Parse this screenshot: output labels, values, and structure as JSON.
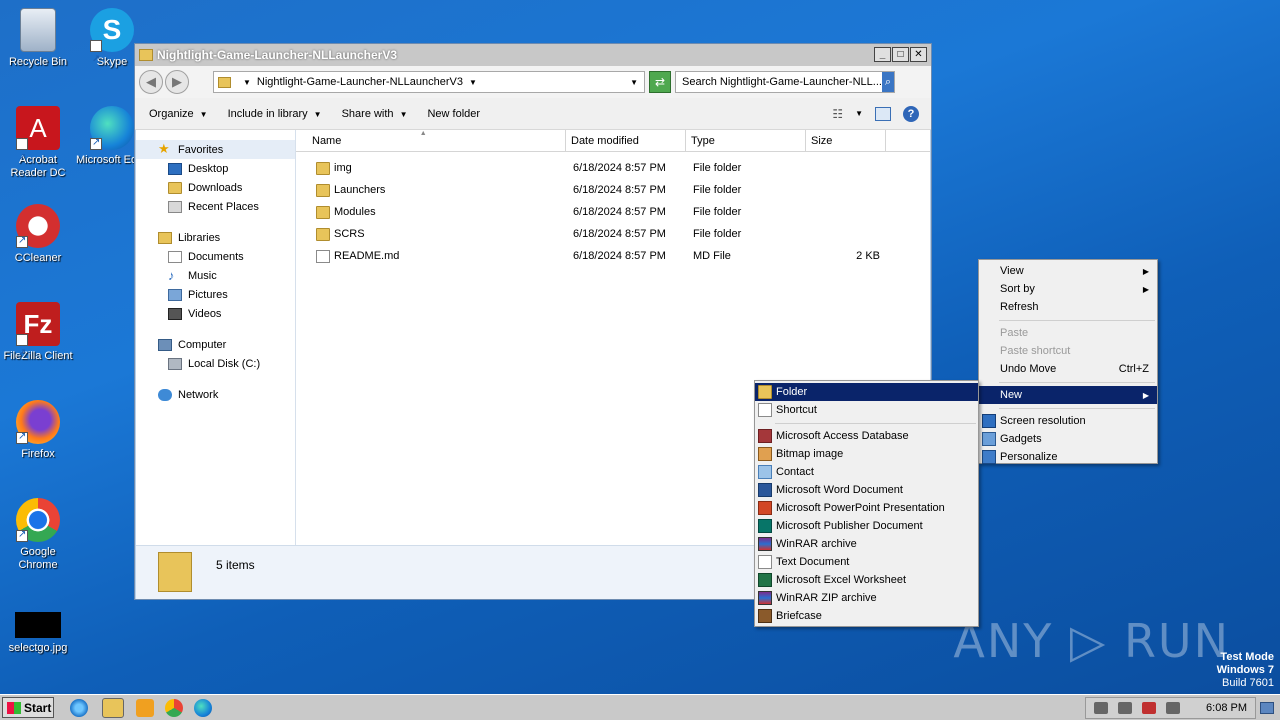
{
  "desktop": {
    "icons": [
      {
        "label": "Recycle Bin"
      },
      {
        "label": "Skype"
      },
      {
        "label": "Acrobat Reader DC"
      },
      {
        "label": "Microsoft Ed"
      },
      {
        "label": "CCleaner"
      },
      {
        "label": "FileZilla Client"
      },
      {
        "label": "Firefox"
      },
      {
        "label": "Google Chrome"
      },
      {
        "label": "selectgo.jpg"
      }
    ],
    "watermark": "ANY ▷ RUN",
    "test_mode": "Test Mode",
    "os_name": "Windows 7",
    "build": "Build 7601"
  },
  "explorer": {
    "title": "Nightlight-Game-Launcher-NLLauncherV3",
    "address": "Nightlight-Game-Launcher-NLLauncherV3",
    "search_placeholder": "Search Nightlight-Game-Launcher-NLL...",
    "toolbar": {
      "organize": "Organize",
      "include_in_library": "Include in library",
      "share_with": "Share with",
      "new_folder": "New folder"
    },
    "nav": {
      "favorites": "Favorites",
      "desktop": "Desktop",
      "downloads": "Downloads",
      "recent_places": "Recent Places",
      "libraries": "Libraries",
      "documents": "Documents",
      "music": "Music",
      "pictures": "Pictures",
      "videos": "Videos",
      "computer": "Computer",
      "local_disk": "Local Disk (C:)",
      "network": "Network"
    },
    "columns": {
      "name": "Name",
      "date": "Date modified",
      "type": "Type",
      "size": "Size"
    },
    "files": [
      {
        "name": "img",
        "date": "6/18/2024 8:57 PM",
        "type": "File folder",
        "size": ""
      },
      {
        "name": "Launchers",
        "date": "6/18/2024 8:57 PM",
        "type": "File folder",
        "size": ""
      },
      {
        "name": "Modules",
        "date": "6/18/2024 8:57 PM",
        "type": "File folder",
        "size": ""
      },
      {
        "name": "SCRS",
        "date": "6/18/2024 8:57 PM",
        "type": "File folder",
        "size": ""
      },
      {
        "name": "README.md",
        "date": "6/18/2024 8:57 PM",
        "type": "MD File",
        "size": "2 KB"
      }
    ],
    "status": "5 items"
  },
  "context_menu": {
    "view": "View",
    "sort_by": "Sort by",
    "refresh": "Refresh",
    "paste": "Paste",
    "paste_shortcut": "Paste shortcut",
    "undo_move": "Undo Move",
    "undo_shortcut": "Ctrl+Z",
    "new": "New",
    "screen_resolution": "Screen resolution",
    "gadgets": "Gadgets",
    "personalize": "Personalize"
  },
  "new_menu": {
    "folder": "Folder",
    "shortcut": "Shortcut",
    "access": "Microsoft Access Database",
    "bitmap": "Bitmap image",
    "contact": "Contact",
    "word": "Microsoft Word Document",
    "powerpoint": "Microsoft PowerPoint Presentation",
    "publisher": "Microsoft Publisher Document",
    "winrar": "WinRAR archive",
    "text": "Text Document",
    "excel": "Microsoft Excel Worksheet",
    "winrar_zip": "WinRAR ZIP archive",
    "briefcase": "Briefcase"
  },
  "taskbar": {
    "start": "Start",
    "clock": "6:08 PM"
  }
}
